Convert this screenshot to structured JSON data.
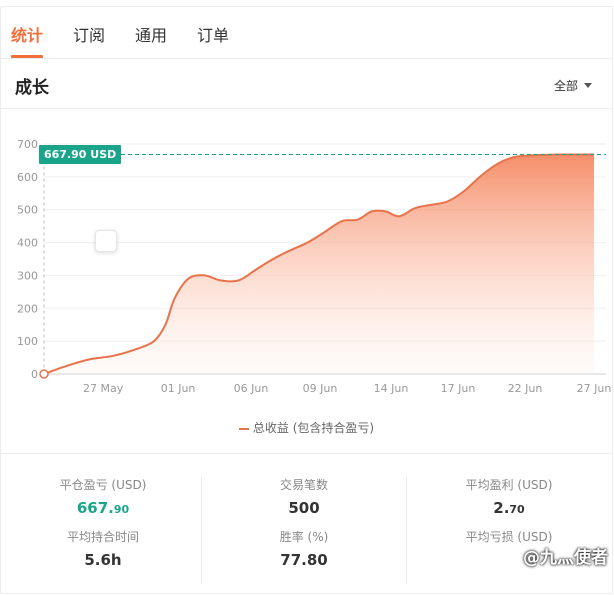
{
  "tabs": [
    {
      "label": "统计",
      "active": true
    },
    {
      "label": "订阅",
      "active": false
    },
    {
      "label": "通用",
      "active": false
    },
    {
      "label": "订单",
      "active": false
    }
  ],
  "section": {
    "title": "成长",
    "range_label": "全部"
  },
  "tooltip": {
    "value_label": "667.90 USD"
  },
  "legend": {
    "label": "总收益 (包含持合盈亏)"
  },
  "colors": {
    "accent": "#f26f3b",
    "line": "#e8734a",
    "green": "#1aa58a"
  },
  "chart_data": {
    "type": "area",
    "ylim": [
      0,
      700
    ],
    "yticks": [
      0,
      100,
      200,
      300,
      400,
      500,
      600,
      700
    ],
    "xticks": [
      "27 May",
      "01 Jun",
      "06 Jun",
      "09 Jun",
      "14 Jun",
      "17 Jun",
      "22 Jun",
      "27 Jun"
    ],
    "x": [
      0,
      1,
      2,
      3,
      4,
      4.8,
      5.3,
      5.7,
      6.3,
      7,
      7.7,
      8.5,
      9.3,
      10,
      10.7,
      11.5,
      12.2,
      13,
      13.7,
      14.3,
      14.9,
      15.5,
      16.2,
      16.9,
      17.6,
      18.3,
      19.1,
      19.8,
      20.5,
      21.2,
      21.9,
      22.6,
      23.3,
      24
    ],
    "series": [
      {
        "values": [
          0,
          25,
          45,
          55,
          75,
          100,
          150,
          230,
          290,
          300,
          285,
          285,
          320,
          350,
          375,
          400,
          430,
          465,
          470,
          495,
          495,
          480,
          505,
          515,
          525,
          555,
          605,
          640,
          660,
          665,
          667,
          668,
          668,
          668
        ]
      }
    ],
    "reference_value": 667.9
  },
  "stats": {
    "col1": {
      "top_label": "平仓盈亏 (USD)",
      "top_value_main": "667.",
      "top_value_small": "90",
      "bot_label": "平均持合时间",
      "bot_value": "5.6h"
    },
    "col2": {
      "top_label": "交易笔数",
      "top_value": "500",
      "bot_label": "胜率 (%)",
      "bot_value": "77.80"
    },
    "col3": {
      "top_label": "平均盈利 (USD)",
      "top_value_main": "2.",
      "top_value_small": "70",
      "bot_label": "平均亏损 (USD)"
    }
  },
  "watermark": {
    "text": "@九灬使者"
  }
}
